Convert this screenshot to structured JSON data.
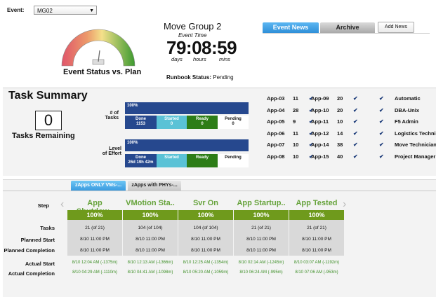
{
  "event": {
    "label": "Event:",
    "value": "MG02"
  },
  "gauge": {
    "caption": "Event Status vs. Plan"
  },
  "header": {
    "title": "Move Group 2",
    "event_time_label": "Event Time",
    "clock": "79:08:59",
    "unit_days": "days",
    "unit_hours": "hours",
    "unit_mins": "mins",
    "runbook_label": "Runbook Status:",
    "runbook_value": "Pending"
  },
  "news": {
    "tab_news": "Event News",
    "tab_archive": "Archive",
    "add_news": "Add News"
  },
  "summary": {
    "title": "Task Summary",
    "remaining_value": "0",
    "remaining_label": "Tasks Remaining",
    "tasks_label_1": "# of",
    "tasks_label_2": "Tasks",
    "effort_label_1": "Level",
    "effort_label_2": "of Effort",
    "tasks_bar_pct": "100%",
    "effort_bar_pct": "100%",
    "tasks_cells": {
      "done": "Done",
      "done_val": "1153",
      "started": "Started",
      "started_val": "0",
      "ready": "Ready",
      "ready_val": "0",
      "pending": "Pending",
      "pending_val": "0"
    },
    "effort_cells": {
      "done": "Done",
      "done_val": "26d 19h 42m",
      "started": "Started",
      "ready": "Ready",
      "pending": "Pending"
    }
  },
  "apps": [
    {
      "name": "App-03",
      "count": "11"
    },
    {
      "name": "App-04",
      "count": "28"
    },
    {
      "name": "App-05",
      "count": "9"
    },
    {
      "name": "App-06",
      "count": "11"
    },
    {
      "name": "App-07",
      "count": "10"
    },
    {
      "name": "App-08",
      "count": "10"
    },
    {
      "name": "App-09",
      "count": "20"
    },
    {
      "name": "App-10",
      "count": "20"
    },
    {
      "name": "App-11",
      "count": "10"
    },
    {
      "name": "App-12",
      "count": "14"
    },
    {
      "name": "App-14",
      "count": "38"
    },
    {
      "name": "App-15",
      "count": "40"
    }
  ],
  "roles": [
    "Automatic",
    "DBA-Unix",
    "F5 Admin",
    "Logistics Technic",
    "Move Technician",
    "Project Manager"
  ],
  "step_tabs": [
    "zApps ONLY VMs-...",
    "zApps with PHYs-..."
  ],
  "rows": {
    "step": "Step",
    "tasks": "Tasks",
    "planned_start": "Planned Start",
    "planned_completion": "Planned Completion",
    "actual_start": "Actual Start",
    "actual_completion": "Actual Completion"
  },
  "steps": [
    {
      "name": "App Shutdow..",
      "pct": "100%",
      "tasks": "21 (of 21)",
      "ps": "8/10 11:00 PM",
      "pc": "8/10 11:00 PM",
      "as": "8/10 12:04 AM (-1375m)",
      "ac": "8/10 04:29 AM (-1110m)"
    },
    {
      "name": "VMotion Sta..",
      "pct": "100%",
      "tasks": "104 (of 104)",
      "ps": "8/10 11:00 PM",
      "pc": "8/10 11:00 PM",
      "as": "8/10 12:13 AM (-1366m)",
      "ac": "8/10 04:41 AM (-1098m)"
    },
    {
      "name": "Svr On",
      "pct": "100%",
      "tasks": "104 (of 104)",
      "ps": "8/10 11:00 PM",
      "pc": "8/10 11:00 PM",
      "as": "8/10 12:25 AM (-1354m)",
      "ac": "8/10 05:20 AM (-1059m)"
    },
    {
      "name": "App Startup..",
      "pct": "100%",
      "tasks": "21 (of 21)",
      "ps": "8/10 11:00 PM",
      "pc": "8/10 11:00 PM",
      "as": "8/10 02:14 AM (-1245m)",
      "ac": "8/10 06:24 AM (-995m)"
    },
    {
      "name": "App Tested",
      "pct": "100%",
      "tasks": "21 (of 21)",
      "ps": "8/10 11:00 PM",
      "pc": "8/10 11:00 PM",
      "as": "8/10 03:07 AM (-1192m)",
      "ac": "8/10 07:06 AM (-953m)"
    }
  ]
}
